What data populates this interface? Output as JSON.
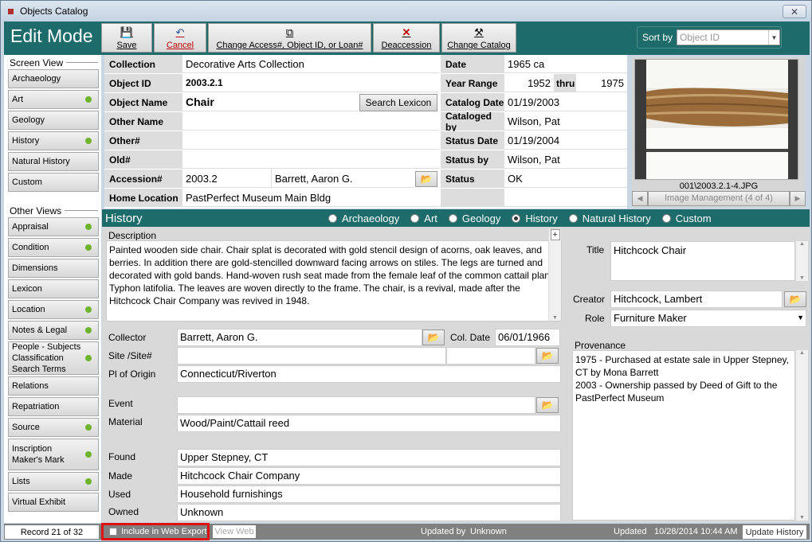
{
  "window": {
    "title": "Objects Catalog",
    "close": "✕"
  },
  "toolbar": {
    "mode": "Edit Mode",
    "save": "Save",
    "cancel": "Cancel",
    "change_access": "Change Access#, Object ID, or Loan#",
    "deaccession": "Deaccession",
    "change_catalog": "Change Catalog",
    "sort_label": "Sort by",
    "sort_value": "Object ID"
  },
  "left": {
    "screen_view_title": "Screen View",
    "screen_views": [
      {
        "label": "Archaeology",
        "dot": false
      },
      {
        "label": "Art",
        "dot": true
      },
      {
        "label": "Geology",
        "dot": false
      },
      {
        "label": "History",
        "dot": true
      },
      {
        "label": "Natural History",
        "dot": false
      },
      {
        "label": "Custom",
        "dot": false
      }
    ],
    "other_views_title": "Other Views",
    "other_views": [
      {
        "label": "Appraisal",
        "dot": true
      },
      {
        "label": "Condition",
        "dot": true
      },
      {
        "label": "Dimensions",
        "dot": false
      },
      {
        "label": "Lexicon",
        "dot": false
      },
      {
        "label": "Location",
        "dot": true
      },
      {
        "label": "Notes & Legal",
        "dot": true
      },
      {
        "label": "People - Subjects\nClassification\nSearch Terms",
        "dot": true
      },
      {
        "label": "Relations",
        "dot": false
      },
      {
        "label": "Repatriation",
        "dot": false
      },
      {
        "label": "Source",
        "dot": true
      },
      {
        "label": "Inscription\nMaker's Mark",
        "dot": true
      },
      {
        "label": "Lists",
        "dot": true
      },
      {
        "label": "Virtual Exhibit",
        "dot": false
      }
    ]
  },
  "record": {
    "collection_label": "Collection",
    "collection": "Decorative Arts Collection",
    "objectid_label": "Object ID",
    "objectid": "2003.2.1",
    "objname_label": "Object Name",
    "objname": "Chair",
    "search_lexicon": "Search Lexicon",
    "othername_label": "Other Name",
    "othername": "",
    "othernum_label": "Other#",
    "othernum": "",
    "old_label": "Old#",
    "old": "",
    "accession_label": "Accession#",
    "accession": "2003.2",
    "accession_source": "Barrett, Aaron G.",
    "homeloc_label": "Home Location",
    "homeloc": "PastPerfect Museum Main Bldg",
    "date_label": "Date",
    "date": "1965 ca",
    "yearrange_label": "Year Range",
    "year_from": "1952",
    "thru": "thru",
    "year_to": "1975",
    "catdate_label": "Catalog Date",
    "catdate": "01/19/2003",
    "catby_label": "Cataloged by",
    "catby": "Wilson, Pat",
    "statusdate_label": "Status Date",
    "statusdate": "01/19/2004",
    "statusby_label": "Status by",
    "statusby": "Wilson, Pat",
    "status_label": "Status",
    "status": "OK"
  },
  "image": {
    "filename": "001\\2003.2.1-4.JPG",
    "management": "Image Management (4 of 4)"
  },
  "history": {
    "title": "History",
    "radios": [
      {
        "label": "Archaeology",
        "on": false
      },
      {
        "label": "Art",
        "on": false
      },
      {
        "label": "Geology",
        "on": false
      },
      {
        "label": "History",
        "on": true
      },
      {
        "label": "Natural History",
        "on": false
      },
      {
        "label": "Custom",
        "on": false
      }
    ],
    "description_label": "Description",
    "description": "Painted wooden side chair. Chair splat is decorated with gold stencil design of acorns, oak leaves, and berries. In addition there are gold-stencilled downward facing arrows on stiles. The legs are turned and decorated with gold bands. Hand-woven rush seat made from the female leaf of the common cattail plant, Typhon latifolia. The leaves are woven directly to the frame. The chair, is a revival, made after the Hitchcock Chair Company was revived in 1948.",
    "collector_label": "Collector",
    "collector": "Barrett, Aaron G.",
    "coldate_label": "Col. Date",
    "coldate": "06/01/1966",
    "site_label": "Site /Site#",
    "site": "",
    "plorigin_label": "Pl of Origin",
    "plorigin": "Connecticut/Riverton",
    "event_label": "Event",
    "event": "",
    "material_label": "Material",
    "material": "Wood/Paint/Cattail reed",
    "found_label": "Found",
    "found": "Upper Stepney, CT",
    "made_label": "Made",
    "made": "Hitchcock Chair Company",
    "used_label": "Used",
    "used": "Household furnishings",
    "owned_label": "Owned",
    "owned": "Unknown",
    "title_label": "Title",
    "title_val": "Hitchcock Chair",
    "creator_label": "Creator",
    "creator": "Hitchcock, Lambert",
    "role_label": "Role",
    "role": "Furniture Maker",
    "provenance_label": "Provenance",
    "provenance": "1975 - Purchased at estate sale in Upper Stepney, CT by Mona Barrett\n2003 - Ownership passed by Deed of Gift to the PastPerfect Museum"
  },
  "status": {
    "record": "Record 21 of 32",
    "web_export": "Include in Web Export",
    "view_web": "View Web",
    "updated_by_label": "Updated by",
    "updated_by": "Unknown",
    "updated_label": "Updated",
    "updated": "10/28/2014 10:44 AM",
    "update_history": "Update History"
  }
}
